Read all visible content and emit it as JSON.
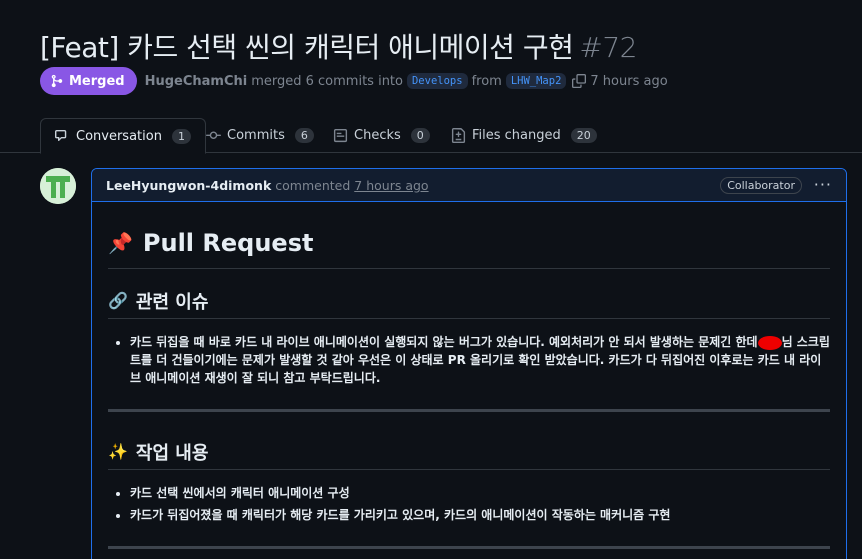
{
  "pr": {
    "title": "[Feat] 카드 선택 씬의 캐릭터 애니메이션 구현",
    "number": "#72",
    "status": "Merged",
    "author": "HugeChamChi",
    "merge_text": "merged 6 commits into",
    "base_branch": "Develops",
    "from_text": "from",
    "head_branch": "LHW_Map2",
    "time": "7 hours ago"
  },
  "tabs": [
    {
      "label": "Conversation",
      "count": "1",
      "icon": "conversation-icon"
    },
    {
      "label": "Commits",
      "count": "6",
      "icon": "commit-icon"
    },
    {
      "label": "Checks",
      "count": "0",
      "icon": "checks-icon"
    },
    {
      "label": "Files changed",
      "count": "20",
      "icon": "file-diff-icon"
    }
  ],
  "comment": {
    "author": "LeeHyungwon-4dimonk",
    "action": "commented",
    "time": "7 hours ago",
    "badge": "Collaborator",
    "menu": "···",
    "heading": "Pull Request",
    "heading_emoji": "📌",
    "section1": {
      "emoji": "🔗",
      "title": "관련 이슈",
      "item_a": "카드 뒤집을 때 바로 카드 내 라이브 애니메이션이 실행되지 않는 버그가 있습니다. 예외처리가 안 되서 발생하는 문제긴 한데",
      "item_b": "님 스크립트를 더 건들이기에는 문제가 발생할 것 같아 우선은 이 상태로 PR 올리기로 확인 받았습니다. 카드가 다 뒤집어진 이후로는 카드 내 라이브 애니메이션 재생이 잘 되니 참고 부탁드립니다."
    },
    "section2": {
      "emoji": "✨",
      "title": "작업 내용",
      "items": [
        "카드 선택 씬에서의 캐릭터 애니메이션 구성",
        "카드가 뒤집어졌을 때 캐릭터가 해당 카드를 가리키고 있으며, 카드의 애니메이션이 작동하는 매커니즘 구현"
      ]
    }
  },
  "colors": {
    "merged": "#8957e5",
    "accent": "#1f6feb",
    "background": "#0d1117"
  }
}
